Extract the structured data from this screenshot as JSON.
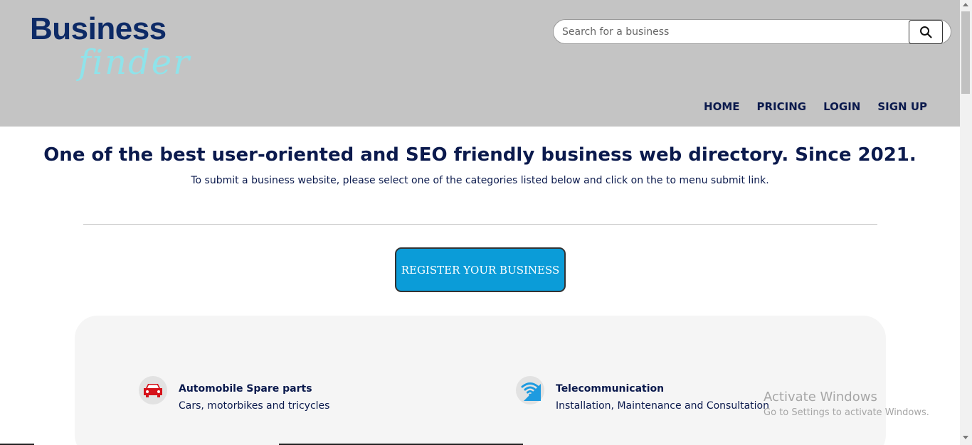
{
  "header": {
    "logo_main": "Business",
    "logo_script": "finder",
    "search": {
      "placeholder": "Search for a business",
      "value": ""
    },
    "nav": [
      "HOME",
      "PRICING",
      "LOGIN",
      "SIGN UP"
    ]
  },
  "hero": {
    "headline": "One of the best user-oriented and SEO friendly business web directory. Since 2021.",
    "subtext": "To submit a business website, please select one of the categories listed below and click on the to menu submit link.",
    "register_label": "REGISTER YOUR BUSINESS"
  },
  "categories": [
    {
      "title": "Automobile Spare parts",
      "desc": "Cars, motorbikes and tricycles",
      "icon": "car-icon"
    },
    {
      "title": "Telecommunication",
      "desc": "Installation, Maintenance and Consultation",
      "icon": "wifi-signal-icon"
    }
  ],
  "watermark": {
    "line1": "Activate Windows",
    "line2": "Go to Settings to activate Windows."
  },
  "colors": {
    "header_bg": "#c4c4c4",
    "navy": "#0b1a4d",
    "accent": "#0b9cd8",
    "panel_bg": "#f5f5f5",
    "car_red": "#d6121a",
    "wifi_blue": "#1e9be0"
  }
}
